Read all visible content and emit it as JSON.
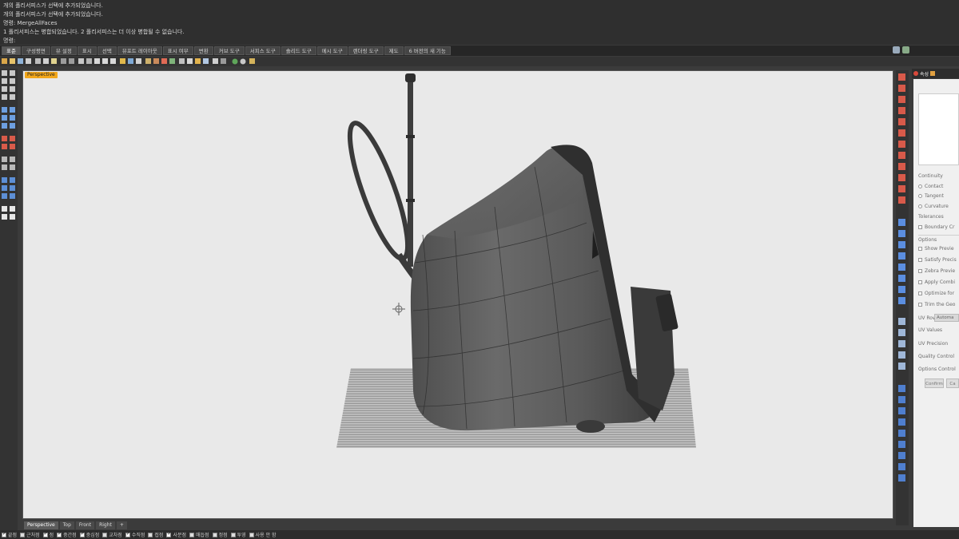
{
  "command_history": [
    "개의 폴리서피스가 선택에 추가되었습니다.",
    "개의 폴리서피스가 선택에 추가되었습니다.",
    "명령: MergeAllFaces",
    "1 폴리서피스는 병합되었습니다. 2 폴리서피스는 더 이상 병합될 수 없습니다.",
    "명령:"
  ],
  "tabs": [
    {
      "label": "표준",
      "active": true
    },
    {
      "label": "구성평면",
      "active": false
    },
    {
      "label": "뷰 설정",
      "active": false
    },
    {
      "label": "표시",
      "active": false
    },
    {
      "label": "선택",
      "active": false
    },
    {
      "label": "뷰포트 레이아웃",
      "active": false
    },
    {
      "label": "표시 여부",
      "active": false
    },
    {
      "label": "변환",
      "active": false
    },
    {
      "label": "커브 도구",
      "active": false
    },
    {
      "label": "서피스 도구",
      "active": false
    },
    {
      "label": "솔리드 도구",
      "active": false
    },
    {
      "label": "메시 도구",
      "active": false
    },
    {
      "label": "렌더링 도구",
      "active": false
    },
    {
      "label": "제도",
      "active": false
    },
    {
      "label": "6 버전의 새 기능",
      "active": false
    }
  ],
  "viewport": {
    "title": "Perspective"
  },
  "view_tabs": [
    {
      "label": "Perspective",
      "active": true
    },
    {
      "label": "Top",
      "active": false
    },
    {
      "label": "Front",
      "active": false
    },
    {
      "label": "Right",
      "active": false
    }
  ],
  "panel": {
    "tab_label": "속성",
    "continuity_label": "Continuity",
    "contact_label": "Contact",
    "tangent_label": "Tangent",
    "curvature_label": "Curvature",
    "tolerances_label": "Tolerances",
    "boundary_label": "Boundary Cr",
    "options_label": "Options",
    "show_preview_label": "Show Previe",
    "satisfy_label": "Satisfy Precis",
    "zebra_label": "Zebra Previe",
    "apply_label": "Apply Combi",
    "optimize_label": "Optimize for",
    "trim_label": "Trim the Geo",
    "uv_rows_label": "UV Rows",
    "uv_rows_value": "Automa",
    "uv_values_label": "UV Values",
    "uv_precision_label": "UV Precision",
    "quality_label": "Quality Control",
    "options_control_label": "Options Control",
    "btn1_label": "Confirm",
    "btn2_label": "Ca"
  },
  "osnap": [
    {
      "label": "끝점",
      "on": true
    },
    {
      "label": "근처점",
      "on": false
    },
    {
      "label": "점",
      "on": true
    },
    {
      "label": "중간점",
      "on": true
    },
    {
      "label": "중심점",
      "on": true
    },
    {
      "label": "교차점",
      "on": false
    },
    {
      "label": "수직점",
      "on": true
    },
    {
      "label": "접점",
      "on": false
    },
    {
      "label": "사분점",
      "on": true
    },
    {
      "label": "매듭점",
      "on": false
    },
    {
      "label": "정점",
      "on": false
    },
    {
      "label": "투영",
      "on": false
    },
    {
      "label": "사용 안 함",
      "on": false
    }
  ],
  "colors": {
    "viewport_bg": "#e9e9e9",
    "viewport_title": "#f3a71a",
    "model_dark": "#4a4a4a",
    "model_mid": "#6b6b6b"
  }
}
